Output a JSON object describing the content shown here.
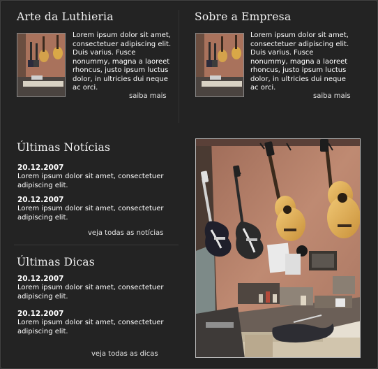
{
  "sections": {
    "luthieria": {
      "title": "Arte da Luthieria",
      "text": "Lorem ipsum dolor sit amet, consectetuer adipiscing elit. Duis varius. Fusce nonummy, magna a laoreet rhoncus, justo ipsum luctus dolor, in ultricies dui neque ac orci.",
      "more": "saiba mais"
    },
    "empresa": {
      "title": "Sobre a Empresa",
      "text": "Lorem ipsum dolor sit amet, consectetuer adipiscing elit. Duis varius. Fusce nonummy, magna a laoreet rhoncus, justo ipsum luctus dolor, in ultricies dui neque ac orci.",
      "more": "saiba mais"
    },
    "noticias": {
      "title": "Últimas Notícias",
      "items": [
        {
          "date": "20.12.2007",
          "text": "Lorem ipsum dolor sit amet, consectetuer adipiscing elit."
        },
        {
          "date": "20.12.2007",
          "text": "Lorem ipsum dolor sit amet, consectetuer adipiscing elit."
        }
      ],
      "more": "veja todas as notícias"
    },
    "dicas": {
      "title": "Últimas Dicas",
      "items": [
        {
          "date": "20.12.2007",
          "text": "Lorem ipsum dolor sit amet, consectetuer adipiscing elit."
        },
        {
          "date": "20.12.2007",
          "text": "Lorem ipsum dolor sit amet, consectetuer adipiscing elit."
        }
      ],
      "more": "veja todas as dicas"
    }
  },
  "colors": {
    "background": "#232323",
    "wall": "#b7826c",
    "text": "#ffffff"
  }
}
